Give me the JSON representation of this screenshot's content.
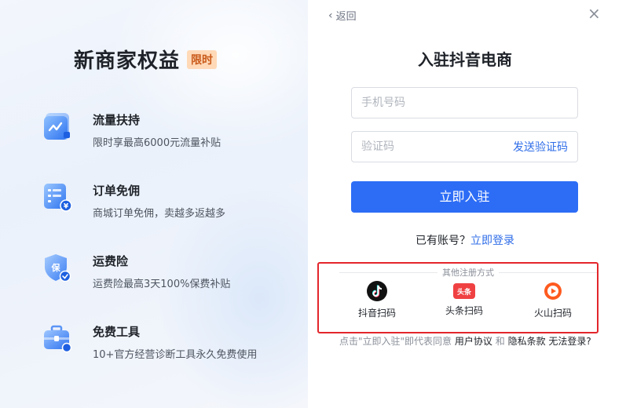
{
  "promo": {
    "title": "新商家权益",
    "badge": "限时",
    "benefits": [
      {
        "title": "流量扶持",
        "desc": "限时享最高6000元流量补贴",
        "icon": "traffic-icon"
      },
      {
        "title": "订单免佣",
        "desc": "商城订单免佣，卖越多返越多",
        "icon": "order-icon"
      },
      {
        "title": "运费险",
        "desc": "运费险最高3天100%保费补贴",
        "icon": "shield-icon"
      },
      {
        "title": "免费工具",
        "desc": "10+官方经营诊断工具永久免费使用",
        "icon": "toolbox-icon"
      }
    ],
    "colors": {
      "accent": "#2d6df6",
      "badge_bg": "#ffd9b8",
      "badge_text": "#c95a1a"
    }
  },
  "header": {
    "back_label": "返回",
    "close_glyph": "×"
  },
  "form": {
    "title": "入驻抖音电商",
    "phone_placeholder": "手机号码",
    "phone_value": "",
    "code_placeholder": "验证码",
    "code_value": "",
    "send_code_label": "发送验证码",
    "submit_label": "立即入驻",
    "has_account_text": "已有账号？",
    "login_link": "立即登录"
  },
  "other": {
    "label": "其他注册方式",
    "options": [
      {
        "label": "抖音扫码",
        "icon": "douyin-icon"
      },
      {
        "label": "头条扫码",
        "icon": "toutiao-icon"
      },
      {
        "label": "火山扫码",
        "icon": "huoshan-icon"
      }
    ]
  },
  "agreement": {
    "prefix": "点击\"立即入驻\"即代表同意",
    "user_agreement": "用户协议",
    "and": "和",
    "privacy": "隐私条款",
    "cannot_login": "无法登录?"
  }
}
